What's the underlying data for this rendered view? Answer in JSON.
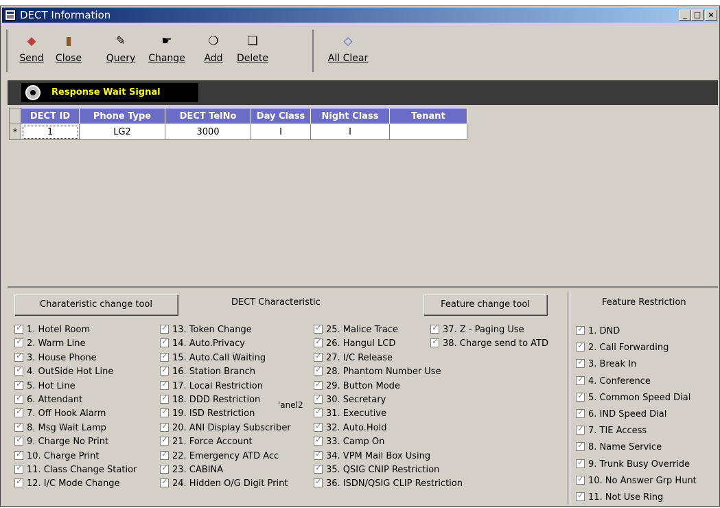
{
  "window": {
    "title": "DECT Information"
  },
  "toolbar": {
    "send": {
      "label": "Send",
      "icon": "send-icon"
    },
    "close": {
      "label": "Close",
      "icon": "close-door-icon"
    },
    "query": {
      "label": "Query",
      "icon": "query-icon"
    },
    "change": {
      "label": "Change",
      "icon": "change-icon"
    },
    "add": {
      "label": "Add",
      "icon": "add-icon"
    },
    "delete": {
      "label": "Delete",
      "icon": "delete-icon"
    },
    "all_clear": {
      "label": "All Clear",
      "icon": "all-clear-icon"
    }
  },
  "signal": {
    "label": "Response Wait Signal"
  },
  "grid": {
    "columns": [
      "DECT ID",
      "Phone Type",
      "DECT TelNo",
      "Day Class",
      "Night Class",
      "Tenant"
    ],
    "rows": [
      {
        "marker": "*",
        "cells": [
          "1",
          "LG2",
          "3000",
          "I",
          "I",
          ""
        ]
      }
    ]
  },
  "characteristic": {
    "change_tool_label": "Charateristic change tool",
    "section_label": "DECT Characteristic",
    "feature_tool_label": "Feature change tool",
    "stray_text": "'anel2",
    "col1": [
      "1. Hotel Room",
      "2. Warm Line",
      "3. House Phone",
      "4. OutSide Hot Line",
      "5. Hot Line",
      "6. Attendant",
      "7. Off Hook Alarm",
      "8. Msg Wait Lamp",
      "9. Charge No Print",
      "10. Charge Print",
      "11. Class Change Statior",
      "12. I/C Mode Change"
    ],
    "col2": [
      "13. Token Change",
      "14. Auto.Privacy",
      "15. Auto.Call Waiting",
      "16. Station Branch",
      "17. Local Restriction",
      "18. DDD Restriction",
      "19. ISD Restriction",
      "20. ANI Display Subscriber",
      "21. Force Account",
      "22. Emergency ATD Acc",
      "23. CABINA",
      "24. Hidden O/G Digit Print"
    ],
    "col3": [
      "25. Malice Trace",
      "26. Hangul LCD",
      "27. I/C Release",
      "28. Phantom Number Use",
      "29. Button Mode",
      "30. Secretary",
      "31. Executive",
      "32. Auto.Hold",
      "33. Camp On",
      "34. VPM Mail Box Using",
      "35. QSIG CNIP Restriction",
      "36. ISDN/QSIG CLIP Restriction"
    ],
    "col4": [
      "37. Z - Paging Use",
      "38. Charge send to ATD"
    ]
  },
  "restriction": {
    "section_label": "Feature Restriction",
    "items": [
      "1. DND",
      "2. Call Forwarding",
      "3. Break In",
      "4. Conference",
      "5. Common Speed Dial",
      "6. IND Speed Dial",
      "7. TIE Access",
      "8. Name Service",
      "9. Trunk Busy Override",
      "10. No Answer Grp Hunt",
      "11. Not Use Ring"
    ]
  }
}
